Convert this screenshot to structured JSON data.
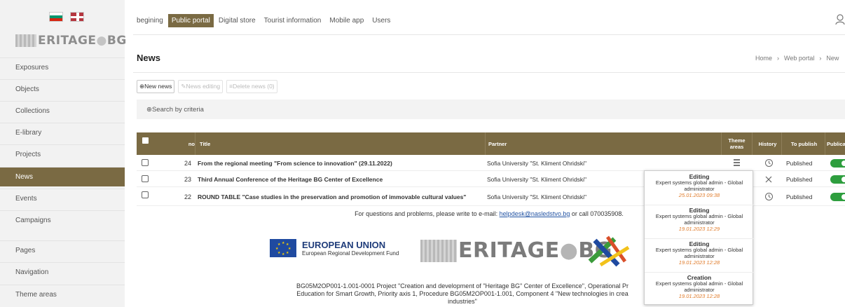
{
  "sidebar": {
    "logo_h": "H",
    "logo_text": "ERITAGE",
    "logo_suffix": "BG",
    "items": [
      {
        "label": "Exposures"
      },
      {
        "label": "Objects"
      },
      {
        "label": "Collections"
      },
      {
        "label": "E-library"
      },
      {
        "label": "Projects"
      },
      {
        "label": "News",
        "active": true
      },
      {
        "label": "Events"
      },
      {
        "label": "Campaigns"
      },
      {
        "label": "Pages"
      },
      {
        "label": "Navigation"
      },
      {
        "label": "Theme areas"
      }
    ]
  },
  "topnav": {
    "tabs": [
      {
        "label": "begining"
      },
      {
        "label": "Public portal",
        "active": true
      },
      {
        "label": "Digital store"
      },
      {
        "label": "Tourist information"
      },
      {
        "label": "Mobile app"
      },
      {
        "label": "Users"
      }
    ]
  },
  "page": {
    "title": "News",
    "breadcrumb": [
      "Home",
      "Web portal",
      "New"
    ]
  },
  "actions": {
    "new_news": "⊕New news",
    "edit_news": "✎News editing",
    "delete_news": "≡Delete news (0)"
  },
  "search": {
    "label": "⊕Search by criteria"
  },
  "table": {
    "headers": {
      "no": "no",
      "title": "Title",
      "partner": "Partner",
      "theme_areas_1": "Theme",
      "theme_areas_2": "areas",
      "history": "History",
      "to_publish": "To publish",
      "publication": "Publicati"
    },
    "rows": [
      {
        "no": "24",
        "title": "From the regional meeting \"From science to innovation\" (29.11.2022)",
        "partner": "Sofia University \"St. Kliment Ohridski\"",
        "status": "Published",
        "published": true
      },
      {
        "no": "23",
        "title": "Third Annual Conference of the Heritage BG Center of Excellence",
        "partner": "Sofia University \"St. Kliment Ohridski\"",
        "status": "Published",
        "published": true
      },
      {
        "no": "22",
        "title": "ROUND TABLE \"Case studies in the preservation and promotion of immovable cultural values\"",
        "partner": "Sofia University \"St. Kliment Ohridski\"",
        "status": "Published",
        "published": true
      }
    ]
  },
  "history_popup": {
    "entries": [
      {
        "type": "Editing",
        "user": "Expert systems global admin - Global administrator",
        "date": "25.01.2023 09:38"
      },
      {
        "type": "Editing",
        "user": "Expert systems global admin - Global administrator",
        "date": "19.01.2023 12:29"
      },
      {
        "type": "Editing",
        "user": "Expert systems global admin - Global administrator",
        "date": "19.01.2023 12:28"
      },
      {
        "type": "Creation",
        "user": "Expert systems global admin - Global administrator",
        "date": "19.01.2023 12:28"
      }
    ]
  },
  "footer": {
    "note_prefix": "For questions and problems, please write to e-mail: ",
    "email": "helpdesk@nasledstvo.bg",
    "note_suffix": " or call 070035908.",
    "eu_title": "EUROPEAN UNION",
    "eu_sub": "European Regional Development Fund",
    "hbg_logo_text": "ERITAGE",
    "hbg_logo_suffix": "BG",
    "project_text_1": "BG05M2OP001-1.001-0001 Project \"Creation and development of \"Heritage BG\" Center of Excellence\", Operational Pr",
    "project_text_2": "Education for Smart Growth, Priority axis 1, Procedure BG05M2OP001-1.001, Component 4 \"New technologies in crea",
    "project_text_3": "industries\""
  },
  "colors": {
    "accent": "#7a6a43",
    "toggle_on": "#2e9e3e",
    "date_orange": "#e07b2a",
    "link": "#2253a3"
  }
}
